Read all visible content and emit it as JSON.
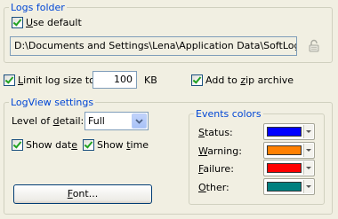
{
  "logs_folder": {
    "title": "Logs folder",
    "use_default": {
      "label": "Use default",
      "underline": "U",
      "rest": "se default",
      "checked": true
    },
    "path": "D:\\Documents and Settings\\Lena\\Application Data\\SoftLogica\\Ba",
    "lock_icon": "lock-icon"
  },
  "limit": {
    "label_pre": "",
    "underline": "L",
    "label_rest": "imit log size to",
    "checked": true,
    "value": "100",
    "unit": "KB"
  },
  "zip": {
    "label_pre": "Add to ",
    "underline": "z",
    "label_rest": "ip archive",
    "checked": true
  },
  "logview": {
    "title": "LogView settings",
    "detail_label_pre": "Level of ",
    "detail_underline": "d",
    "detail_label_rest": "etail:",
    "detail_value": "Full",
    "show_date": {
      "pre": "Show dat",
      "underline": "e",
      "rest": "",
      "checked": true
    },
    "show_time": {
      "pre": "Show ",
      "underline": "t",
      "rest": "ime",
      "checked": true
    },
    "font_button": {
      "pre": "",
      "underline": "F",
      "rest": "ont..."
    }
  },
  "events": {
    "title": "Events colors",
    "items": [
      {
        "pre": "",
        "underline": "S",
        "rest": "tatus:",
        "color": "#0000ff"
      },
      {
        "pre": "",
        "underline": "W",
        "rest": "arning:",
        "color": "#ff8000"
      },
      {
        "pre": "",
        "underline": "F",
        "rest": "ailure:",
        "color": "#ff0000"
      },
      {
        "pre": "",
        "underline": "O",
        "rest": "ther:",
        "color": "#008080"
      }
    ]
  }
}
